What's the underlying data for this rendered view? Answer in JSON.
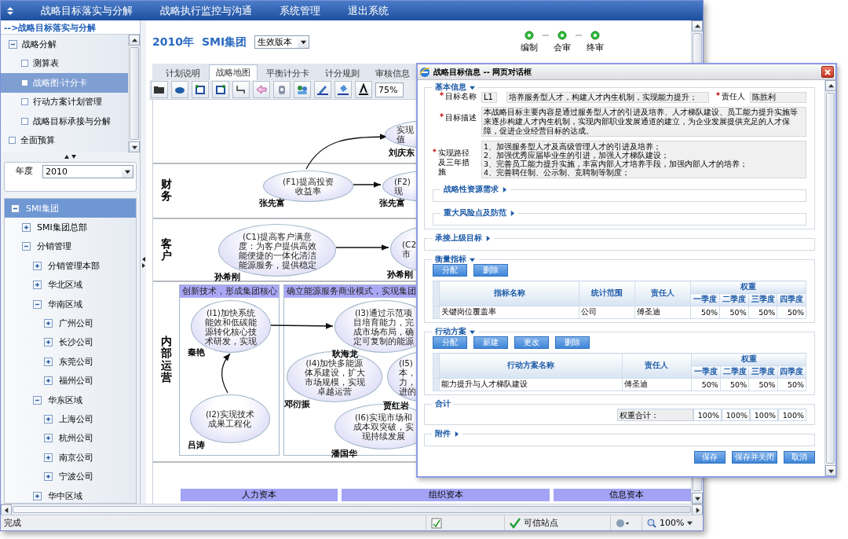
{
  "menu": [
    "战略目标落实与分解",
    "战略执行监控与沟通",
    "系统管理",
    "退出系统"
  ],
  "nav": {
    "title": "-->战略目标落实与分解",
    "items": [
      {
        "label": "战略分解",
        "expanded": true,
        "selected": false,
        "children": [
          {
            "label": "测算表",
            "selected": false
          },
          {
            "label": "战略图·计分卡",
            "selected": true
          },
          {
            "label": "行动方案计划管理",
            "selected": false
          },
          {
            "label": "战略目标承接与分解",
            "selected": false
          }
        ]
      },
      {
        "label": "全面预算",
        "selected": false
      }
    ]
  },
  "year": {
    "label": "年度",
    "value": "2010"
  },
  "org_tree": [
    {
      "label": "SMI集团",
      "selected": true,
      "expanded": true,
      "children": [
        {
          "label": "SMI集团总部",
          "selected": false,
          "expanded": false
        },
        {
          "label": "分销管理",
          "selected": false,
          "expanded": true,
          "children": [
            {
              "label": "分销管理本部",
              "selected": false,
              "expanded": false
            },
            {
              "label": "华北区域",
              "selected": false,
              "expanded": false
            },
            {
              "label": "华南区域",
              "selected": false,
              "expanded": true,
              "children": [
                {
                  "label": "广州公司",
                  "selected": false,
                  "expanded": false
                },
                {
                  "label": "长沙公司",
                  "selected": false,
                  "expanded": false
                },
                {
                  "label": "东莞公司",
                  "selected": false,
                  "expanded": false
                },
                {
                  "label": "福州公司",
                  "selected": false,
                  "expanded": false
                }
              ]
            },
            {
              "label": "华东区域",
              "selected": false,
              "expanded": true,
              "children": [
                {
                  "label": "上海公司",
                  "selected": false,
                  "expanded": false
                },
                {
                  "label": "杭州公司",
                  "selected": false,
                  "expanded": false
                },
                {
                  "label": "南京公司",
                  "selected": false,
                  "expanded": false
                },
                {
                  "label": "宁波公司",
                  "selected": false,
                  "expanded": false
                }
              ]
            },
            {
              "label": "华中区域",
              "selected": false,
              "expanded": false
            }
          ]
        }
      ]
    }
  ],
  "header": {
    "year": "2010年",
    "company": "SMI集团",
    "version": "生效版本"
  },
  "workflow": [
    {
      "label": "编制",
      "done": true
    },
    {
      "label": "会审",
      "done": true
    },
    {
      "label": "终审",
      "done": true
    }
  ],
  "tabs": [
    {
      "label": "计划说明",
      "selected": false
    },
    {
      "label": "战略地图",
      "selected": true
    },
    {
      "label": "平衡计分卡",
      "selected": false
    },
    {
      "label": "计分规则",
      "selected": false
    },
    {
      "label": "审核信息",
      "selected": false
    }
  ],
  "toolbar": {
    "zoom": "75%"
  },
  "map": {
    "lanes": [
      "财务",
      "客户",
      "内部运营"
    ],
    "themes": [
      "创新技术，形成集团核心",
      "确立能源服务商业模式，实现集团"
    ],
    "nodes": [
      {
        "lines": [
          "实现",
          "值"
        ],
        "owner": "刘庆东"
      },
      {
        "lines": [
          "(F1)提高投资",
          "收益率"
        ],
        "owner": "张先富"
      },
      {
        "lines": [
          "(F2)",
          "现"
        ],
        "owner": "张先富"
      },
      {
        "lines": [
          "(C1)提高客户满意",
          "度：为客户提供高效",
          "能便捷的一体化清洁",
          "能源服务，提供稳定"
        ],
        "owner": "孙希刚"
      },
      {
        "lines": [
          "(C2",
          "市"
        ],
        "owner": "孙希刚"
      },
      {
        "lines": [
          "(I1)加快系统",
          "能效和低碳能",
          "源转化核心技",
          "术研发，实现"
        ],
        "owner": "秦艳"
      },
      {
        "lines": [
          "(I2)实现技术",
          "成果工程化"
        ],
        "owner": "吕涛"
      },
      {
        "lines": [
          "(I3)通过示范项",
          "目培育能力，完",
          "成市场布局，确",
          "定可复制的能源"
        ],
        "owner": "耿海龙"
      },
      {
        "lines": [
          "(I4)加快多能源",
          "体系建设，扩大",
          "市场规模，实现",
          "卓越运营"
        ],
        "owner": "邓衍振"
      },
      {
        "lines": [
          "(I5)",
          "本，",
          "力，",
          "进的"
        ],
        "owner": "贾红岩"
      },
      {
        "lines": [
          "(I6)实现市场和",
          "成本双突破，实",
          "现持续发展"
        ],
        "owner": "潘国华"
      }
    ],
    "capitals": [
      "人力资本",
      "组织资本",
      "信息资本"
    ]
  },
  "dialog": {
    "title": "战略目标信息 -- 网页对话框",
    "basic": {
      "title": "基本信息",
      "expanded": true,
      "code_label": {
        "text": "目标名称",
        "required": true
      },
      "code": "L1",
      "name": "培养服务型人才，构建人才内生机制，实现能力提升；",
      "owner_label": {
        "text": "责任人",
        "required": true
      },
      "owner": "陈胜利",
      "description_label": {
        "text": "目标描述",
        "required": true
      },
      "description": "本战略目标主要内容是通过服务型人才的引进及培养、人才梯队建设、员工能力提升实施等来逐步构建人才内生机制，实现内部职业发展通道的建立，为企业发展提供充足的人才保障，促进企业经营目标的达成。",
      "measures_label": {
        "text": "实现路径及三年措施",
        "required": true
      },
      "measures": [
        "1、加强服务型人才及高级管理人才的引进及培养；",
        "2、加强优秀应届毕业生的引进，加强人才梯队建设；",
        "3、完善员工能力提升实施，丰富内部人才培养手段，加强内部人才的培养；",
        "4、完善聘任制、公示制、竞聘制等制度；"
      ],
      "subsections": [
        {
          "title": "战略性资源需求",
          "expanded": false
        },
        {
          "title": "重大风险点及防范",
          "expanded": false
        }
      ]
    },
    "upper_goal": {
      "title": "承接上级目标",
      "expanded": false
    },
    "indicators": {
      "title": "衡量指标",
      "expanded": true,
      "buttons": [
        "分配",
        "删除"
      ],
      "columns": [
        "指标名称",
        "统计范围",
        "责任人"
      ],
      "weight_header": "权重",
      "quarters": [
        "一季度",
        "二季度",
        "三季度",
        "四季度"
      ],
      "rows": [
        {
          "cells": [
            "关键岗位覆盖率",
            "公司",
            "傅圣迪"
          ],
          "weights": [
            "50%",
            "50%",
            "50%",
            "50%"
          ]
        }
      ]
    },
    "actions": {
      "title": "行动方案",
      "expanded": true,
      "buttons": [
        "分配",
        "新建",
        "更改",
        "删除"
      ],
      "columns": [
        "行动方案名称",
        "责任人"
      ],
      "weight_header": "权重",
      "quarters": [
        "一季度",
        "二季度",
        "三季度",
        "四季度"
      ],
      "rows": [
        {
          "cells": [
            "能力提升与人才梯队建设",
            "傅圣迪"
          ],
          "weights": [
            "50%",
            "50%",
            "50%",
            "50%"
          ]
        }
      ]
    },
    "total": {
      "title": "合计",
      "label": "权重合计：",
      "values": [
        "100%",
        "100%",
        "100%",
        "100%"
      ]
    },
    "attachments": {
      "title": "附件",
      "expanded": false
    },
    "footer": [
      "保存",
      "保存并关闭",
      "取消"
    ]
  },
  "status_bar": {
    "text": "完成",
    "zone": "可信站点",
    "zoom": "100%"
  }
}
